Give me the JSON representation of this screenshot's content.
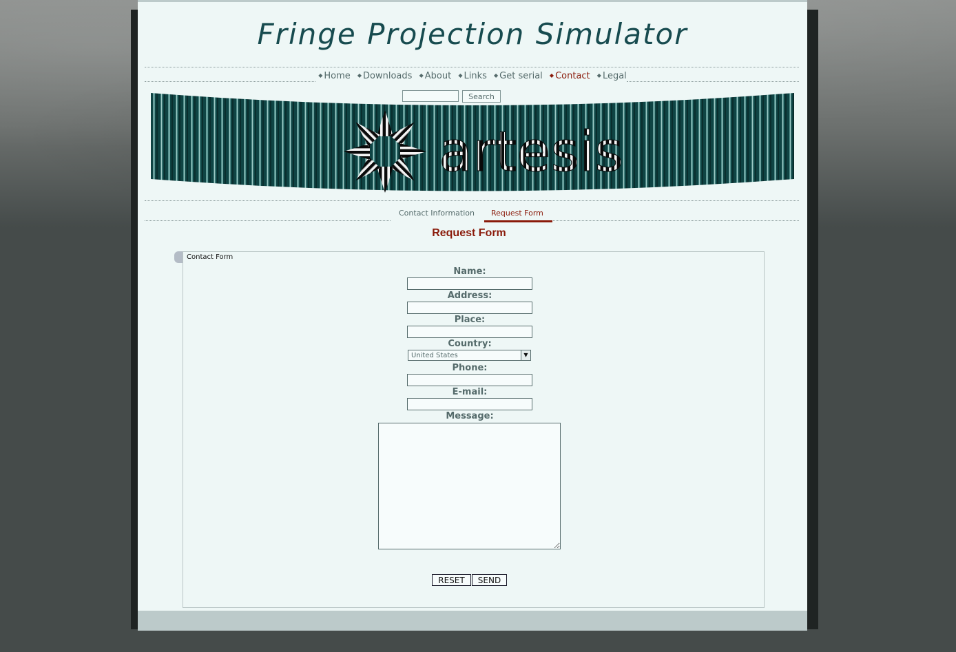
{
  "site": {
    "title": "Fringe Projection Simulator"
  },
  "nav": {
    "items": [
      {
        "label": "Home"
      },
      {
        "label": "Downloads"
      },
      {
        "label": "About"
      },
      {
        "label": "Links"
      },
      {
        "label": "Get serial"
      },
      {
        "label": "Contact"
      },
      {
        "label": "Legal"
      }
    ],
    "active": "Contact"
  },
  "search": {
    "value": "",
    "button_label": "Search"
  },
  "banner": {
    "logo_text": "artesis"
  },
  "subnav": {
    "tabs": [
      {
        "label": "Contact Information"
      },
      {
        "label": "Request Form"
      }
    ],
    "active": "Request Form"
  },
  "section": {
    "title": "Request Form"
  },
  "form": {
    "legend": "Contact Form",
    "fields": {
      "name": {
        "label": "Name:",
        "value": ""
      },
      "address": {
        "label": "Address:",
        "value": ""
      },
      "place": {
        "label": "Place:",
        "value": ""
      },
      "country": {
        "label": "Country:",
        "value": "United States"
      },
      "phone": {
        "label": "Phone:",
        "value": ""
      },
      "email": {
        "label": "E-mail:",
        "value": ""
      },
      "message": {
        "label": "Message:",
        "value": ""
      }
    },
    "buttons": {
      "reset": "RESET",
      "send": "SEND"
    }
  },
  "colors": {
    "background": "#454b4a",
    "page": "#eef7f6",
    "title": "#174b4f",
    "accent": "#8a1a0a",
    "text": "#556b6b",
    "banner": "#0f4444"
  },
  "icons": {
    "nav_bullet": "diamond-bullet-icon",
    "select_arrow": "chevron-down-icon",
    "logo": "star-flower-logo-icon"
  }
}
